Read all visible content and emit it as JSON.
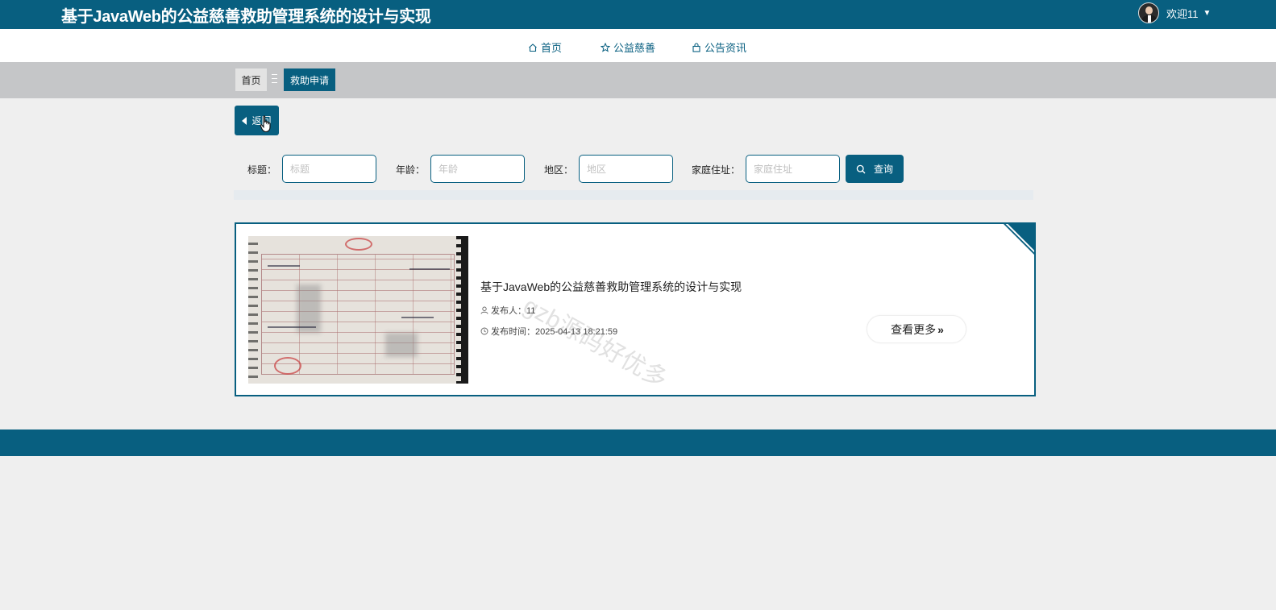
{
  "header": {
    "site_title": "基于JavaWeb的公益慈善救助管理系统的设计与实现",
    "welcome_text": "欢迎11",
    "caret": "▼"
  },
  "nav": {
    "items": [
      {
        "label": "首页",
        "icon": "home-icon"
      },
      {
        "label": "公益慈善",
        "icon": "star-icon"
      },
      {
        "label": "公告资讯",
        "icon": "bag-icon"
      }
    ]
  },
  "breadcrumb": {
    "home": "首页",
    "current": "救助申请"
  },
  "back_button": {
    "label": "返回"
  },
  "search": {
    "fields": [
      {
        "label": "标题：",
        "placeholder": "标题",
        "value": ""
      },
      {
        "label": "年龄：",
        "placeholder": "年龄",
        "value": ""
      },
      {
        "label": "地区：",
        "placeholder": "地区",
        "value": ""
      },
      {
        "label": "家庭住址：",
        "placeholder": "家庭住址",
        "value": ""
      }
    ],
    "button_label": "查询"
  },
  "list": {
    "items": [
      {
        "title": "基于JavaWeb的公益慈善救助管理系统的设计与实现",
        "publisher": "发布人：11",
        "publish_time": "发布时间：2025-04-13 18:21:59",
        "more_label": "查看更多",
        "more_chevron": "»"
      }
    ]
  },
  "watermark": "gzb源码好优多",
  "colors": {
    "primary": "#085f80",
    "page_bg": "#efefef",
    "breadcrumb_bg": "#c5c6c8"
  }
}
